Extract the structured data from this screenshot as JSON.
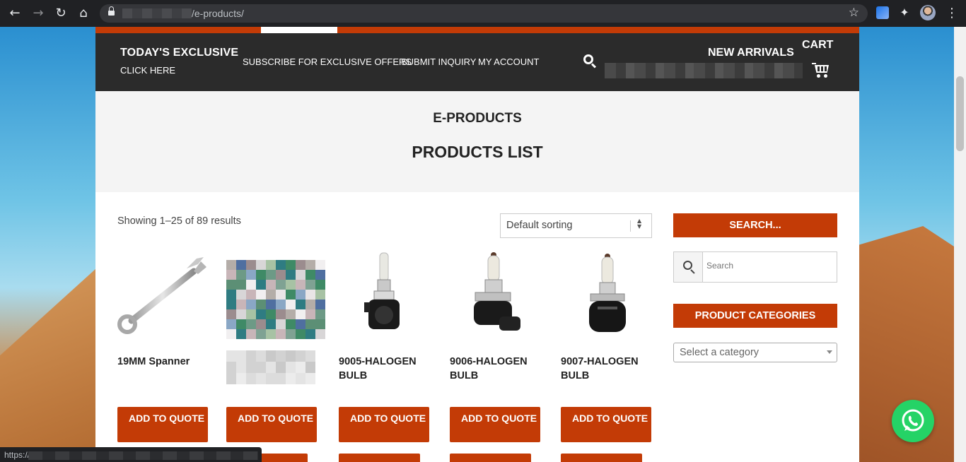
{
  "browser": {
    "url_text": "/e-products/",
    "status_text": "https://"
  },
  "header": {
    "todays_exclusive": "TODAY'S EXCLUSIVE",
    "click_here": "CLICK HERE",
    "nav": [
      "SUBSCRIBE FOR EXCLUSIVE OFFERS",
      "SUBMIT INQUIRY",
      "MY ACCOUNT"
    ],
    "new_arrivals": "NEW ARRIVALS",
    "cart": "CART"
  },
  "page": {
    "section_title": "E-PRODUCTS",
    "list_title": "PRODUCTS LIST",
    "result_count": "Showing 1–25 of 89 results",
    "sorting_value": "Default sorting"
  },
  "products": [
    {
      "name": "19MM Spanner",
      "button": "ADD TO QUOTE",
      "image": "spanner-image"
    },
    {
      "name": "",
      "button": "ADD TO QUOTE",
      "image": "pixelated-image"
    },
    {
      "name": "9005-HALOGEN BULB",
      "button": "ADD TO QUOTE",
      "image": "halogen-bulb-image"
    },
    {
      "name": "9006-HALOGEN BULB",
      "button": "ADD TO QUOTE",
      "image": "halogen-bulb-image"
    },
    {
      "name": "9007-HALOGEN BULB",
      "button": "ADD TO QUOTE",
      "image": "halogen-bulb-image"
    }
  ],
  "sidebar": {
    "search_heading": "SEARCH...",
    "search_placeholder": "Search",
    "categories_heading": "PRODUCT CATEGORIES",
    "category_placeholder": "Select a category"
  },
  "colors": {
    "accent": "#c33b06",
    "header_bg": "#2b2b2b",
    "whatsapp": "#25d366"
  }
}
